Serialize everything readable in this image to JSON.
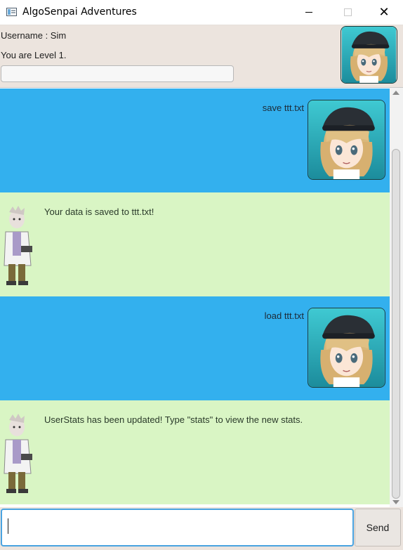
{
  "window": {
    "title": "AlgoSenpai Adventures",
    "min_icon": "minimize-icon",
    "max_icon": "maximize-icon",
    "close_glyph": "✕"
  },
  "header": {
    "username": "Username : Sim",
    "level": "You are Level 1.",
    "level_progress": 0
  },
  "dialog": {
    "messages": [
      {
        "sender": "user",
        "text": "save ttt.txt"
      },
      {
        "sender": "bot",
        "text": "Your data is saved to ttt.txt!"
      },
      {
        "sender": "user",
        "text": "load ttt.txt"
      },
      {
        "sender": "bot",
        "text": "UserStats has been updated! Type \"stats\" to view the new stats."
      }
    ]
  },
  "input": {
    "value": "",
    "placeholder": ""
  },
  "send": {
    "label": "Send"
  },
  "colors": {
    "user_bubble": "#33b0ee",
    "bot_bubble": "#d9f5c4",
    "header_bg": "#ece4de"
  }
}
